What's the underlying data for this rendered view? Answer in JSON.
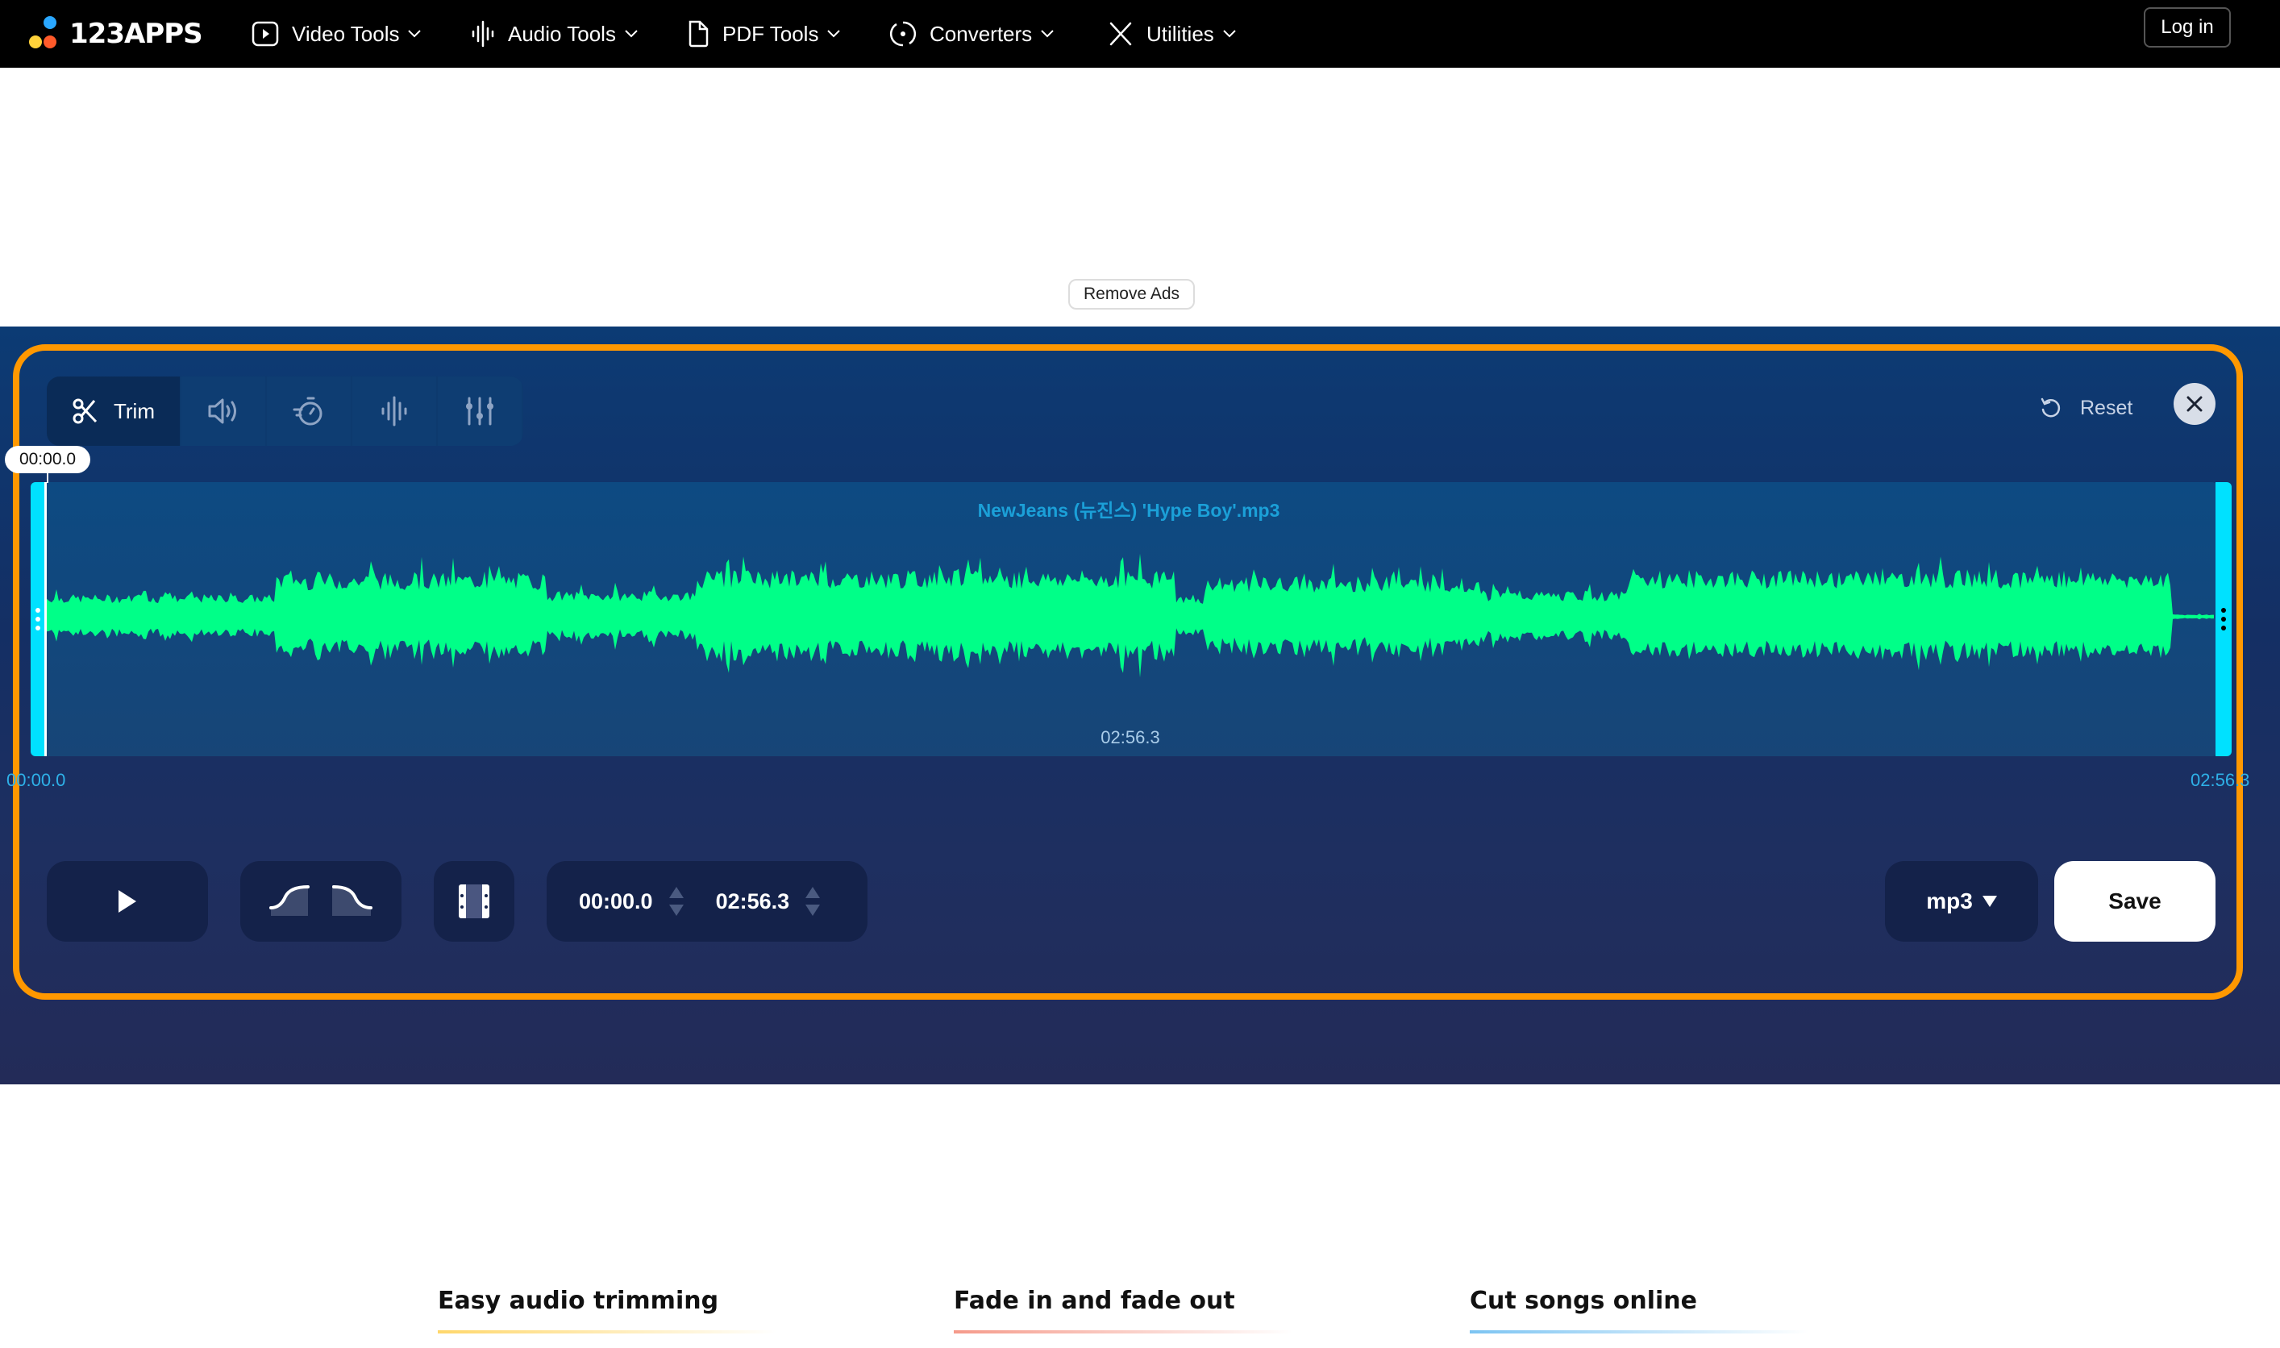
{
  "nav": {
    "logo_text": "123APPS",
    "logo_colors": [
      "#2aa7ff",
      "#ffd23a",
      "#ff5a2a"
    ],
    "items": [
      {
        "label": "Video Tools",
        "icon": "play-box-icon"
      },
      {
        "label": "Audio Tools",
        "icon": "audio-wave-icon"
      },
      {
        "label": "PDF Tools",
        "icon": "document-icon"
      },
      {
        "label": "Converters",
        "icon": "convert-cycle-icon"
      },
      {
        "label": "Utilities",
        "icon": "tools-icon"
      }
    ],
    "login_label": "Log in"
  },
  "ads": {
    "remove_ads_label": "Remove Ads"
  },
  "editor": {
    "accent_color": "#ff9800",
    "toolbar": {
      "tools": [
        {
          "label": "Trim",
          "icon": "scissors-icon",
          "active": true
        },
        {
          "label": "",
          "icon": "volume-icon",
          "active": false
        },
        {
          "label": "",
          "icon": "speed-timer-icon",
          "active": false
        },
        {
          "label": "",
          "icon": "equalizer-wave-icon",
          "active": false
        },
        {
          "label": "",
          "icon": "sliders-icon",
          "active": false
        }
      ]
    },
    "reset_label": "Reset",
    "playhead_time": "00:00.0",
    "file_name": "NewJeans (뉴진스) 'Hype Boy'.mp3",
    "selection_duration": "02:56.3",
    "timeline_start": "00:00.0",
    "timeline_end": "02:56.3",
    "waveform_color": "#00ff88",
    "handle_color": "#00e1ff",
    "controls": {
      "play_icon": "play-icon",
      "fade_in_icon": "fade-in-icon",
      "fade_out_icon": "fade-out-icon",
      "split_icon": "film-split-icon",
      "start_time": "00:00.0",
      "end_time": "02:56.3",
      "format": "mp3",
      "save_label": "Save"
    }
  },
  "features": [
    {
      "title": "Easy audio trimming",
      "color": "#ffd76b"
    },
    {
      "title": "Fade in and fade out",
      "color": "#f59a8a"
    },
    {
      "title": "Cut songs online",
      "color": "#7cc4f2"
    }
  ]
}
